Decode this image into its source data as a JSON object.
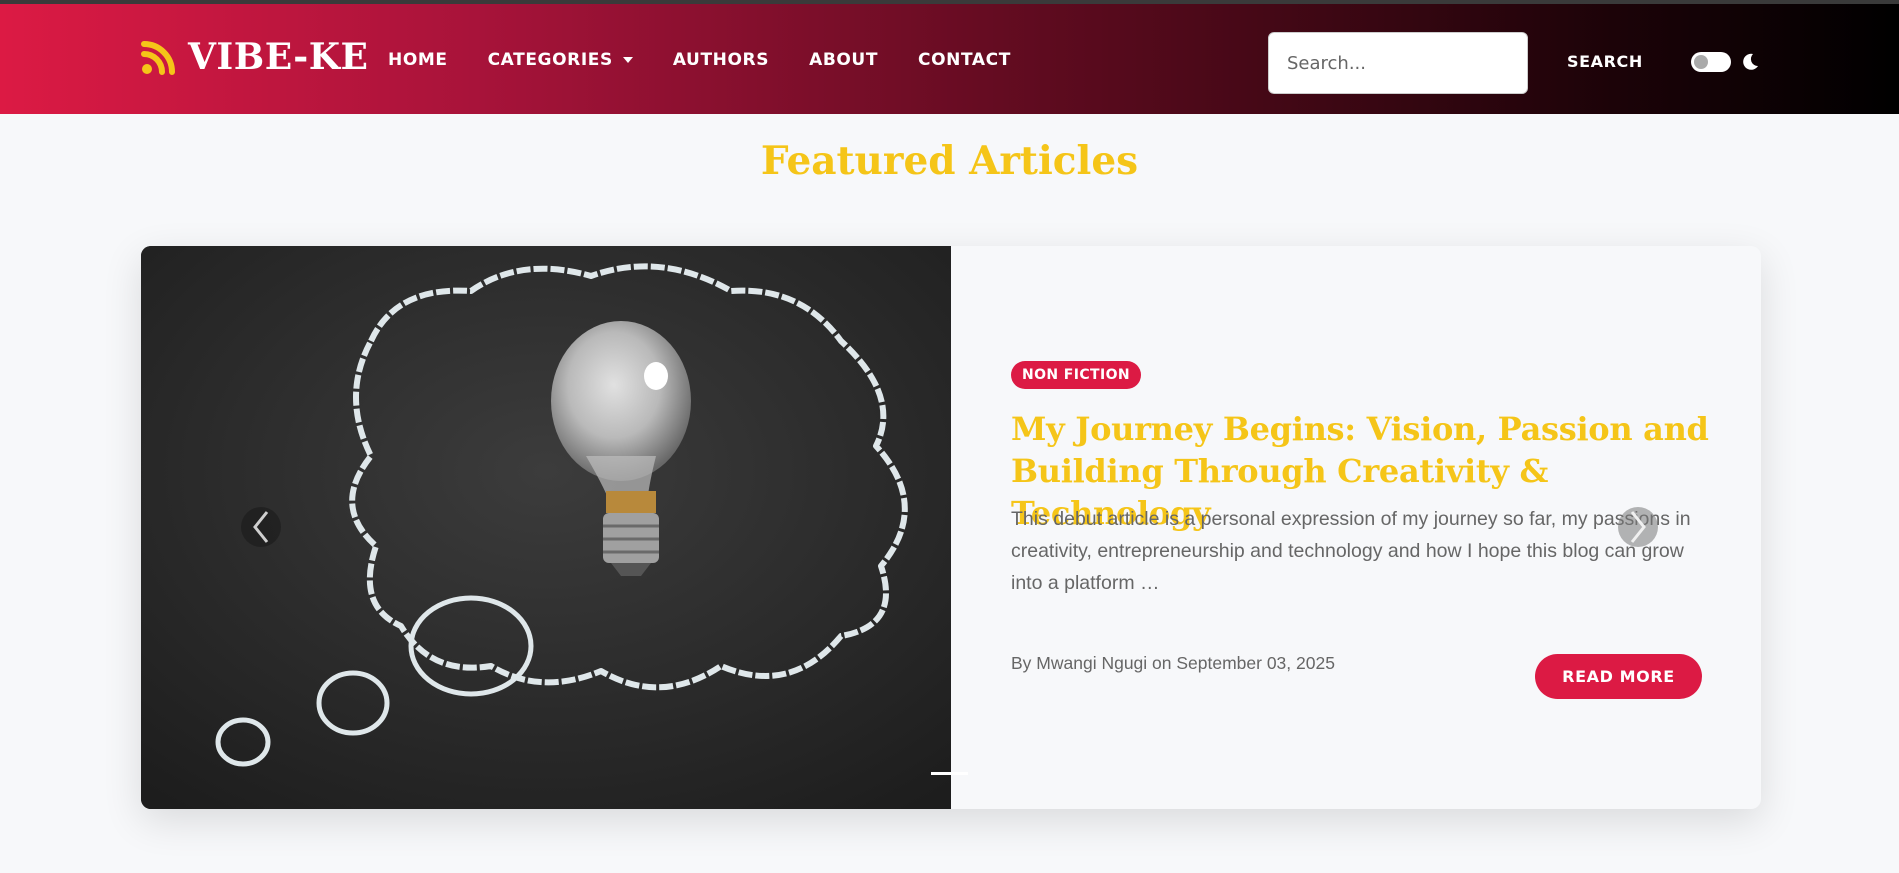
{
  "brand": {
    "name": "VIBE-KE",
    "icon": "rss-feed-icon",
    "icon_color": "#f5c518"
  },
  "nav": {
    "links": [
      {
        "label": "HOME"
      },
      {
        "label": "CATEGORIES",
        "has_dropdown": true
      },
      {
        "label": "AUTHORS"
      },
      {
        "label": "ABOUT"
      },
      {
        "label": "CONTACT"
      }
    ]
  },
  "search": {
    "placeholder": "Search...",
    "value": "",
    "button_label": "SEARCH"
  },
  "theme_toggle": {
    "state": "off",
    "icon": "moon-icon"
  },
  "featured": {
    "section_title": "Featured Articles",
    "slide": {
      "badge": "NON FICTION",
      "title": "My Journey Begins: Vision, Passion and Building Through Creativity & Technology",
      "excerpt": "This debut article is a personal expression of my journey so far, my passions in creativity, entrepreneurship and technology and how I hope this blog can grow into a platform …",
      "byline": "By Mwangi Ngugi on September 03, 2025",
      "read_more_label": "READ MORE"
    }
  },
  "colors": {
    "accent": "#dc1a44",
    "heading_yellow": "#f5c518",
    "navbar_gradient_start": "#dc1a44",
    "navbar_gradient_end": "#000000"
  }
}
